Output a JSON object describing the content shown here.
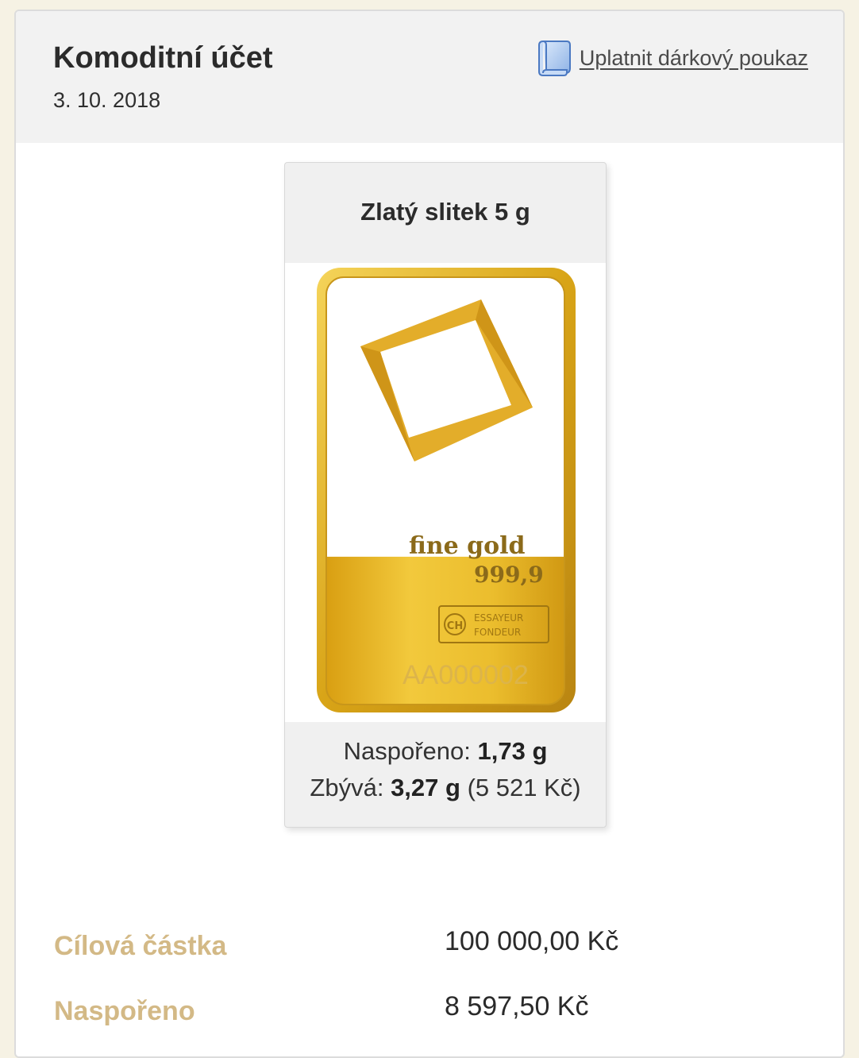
{
  "header": {
    "title": "Komoditní účet",
    "date": "3. 10. 2018",
    "voucher_link": "Uplatnit dárkový poukaz",
    "voucher_icon": "voucher-scroll-icon"
  },
  "card": {
    "title": "Zlatý slitek 5 g",
    "bar_text": {
      "fine_gold": "fine gold",
      "purity": "999,9",
      "stamp_country": "CH",
      "stamp_line1": "ESSAYEUR",
      "stamp_line2": "FONDEUR",
      "serial": "AA000002"
    },
    "fill_fraction": 0.346,
    "saved_label": "Naspořeno:",
    "saved_value": "1,73 g",
    "remaining_label": "Zbývá:",
    "remaining_value": "3,27 g",
    "remaining_amount": "(5 521 Kč)"
  },
  "summary": {
    "target_label": "Cílová částka",
    "target_value": "100 000,00 Kč",
    "saved_label": "Naspořeno",
    "saved_value": "8 597,50 Kč"
  },
  "colors": {
    "gold_label": "#d3b986",
    "gold_bar": "#e8b61e"
  }
}
